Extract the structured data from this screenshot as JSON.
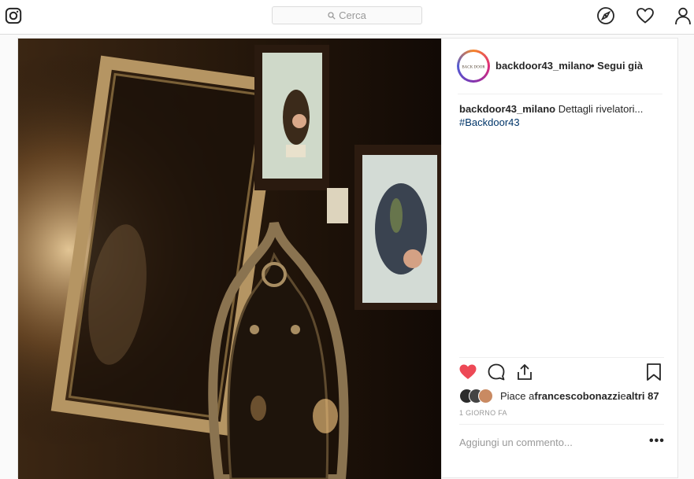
{
  "nav": {
    "logo_icon": "instagram-icon",
    "search_placeholder": "Cerca",
    "explore_icon": "compass-icon",
    "activity_icon": "heart-icon",
    "profile_icon": "person-icon"
  },
  "post": {
    "image_alt": "",
    "author": {
      "username": "backdoor43_milano",
      "follow_status": "• Segui già",
      "avatar_text": "BACK DOOR"
    },
    "caption": {
      "username": "backdoor43_milano",
      "text": " Dettagli rivelatori...",
      "hashtag": "#Backdoor43"
    },
    "likes": {
      "prefix": "Piace a ",
      "first_user": "francescobonazzi",
      "middle": " e ",
      "others": "altri 87"
    },
    "timestamp": "1 GIORNO FA",
    "comment_placeholder": "Aggiungi un commento...",
    "more_label": "•••",
    "liked": true,
    "colors": {
      "like": "#ed4956",
      "hashtag": "#003569"
    }
  }
}
